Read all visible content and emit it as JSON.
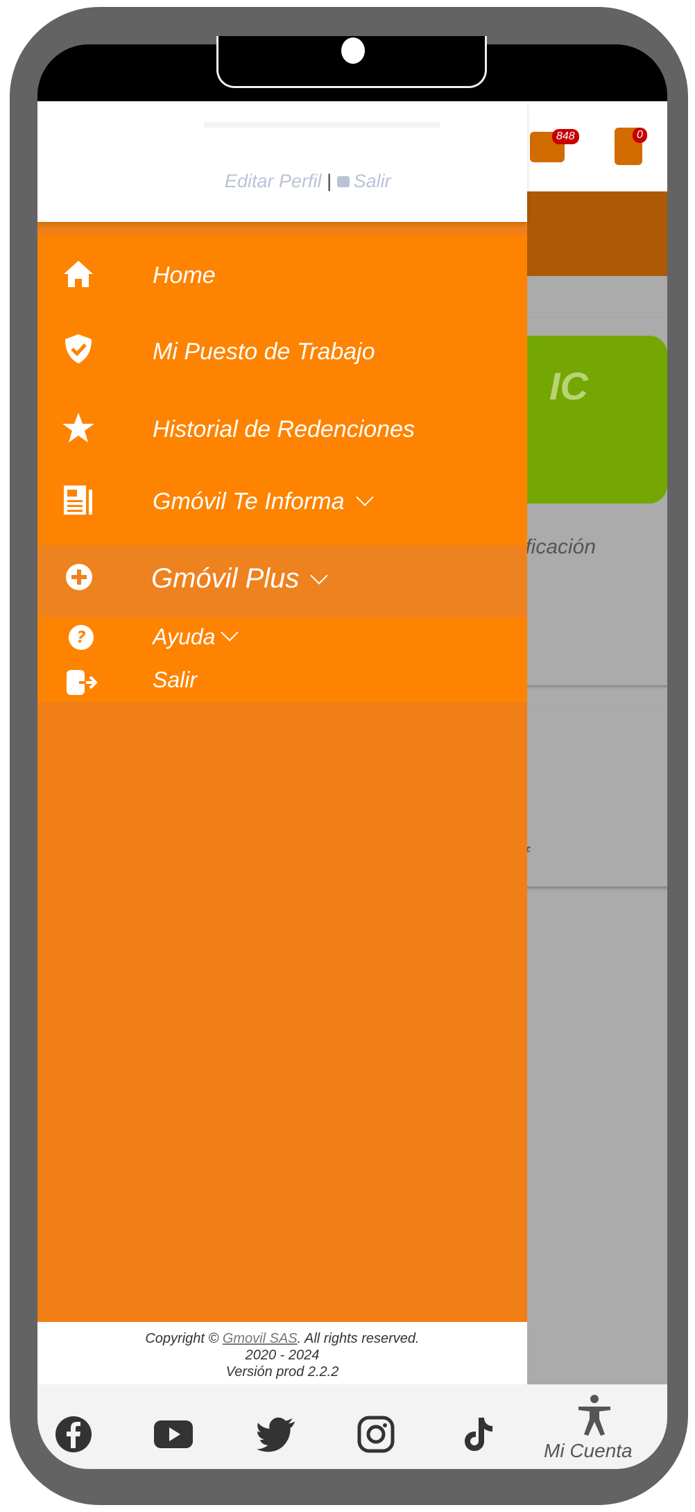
{
  "background_app": {
    "mail_badge": "848",
    "doc_badge": "0",
    "card_text_partial": "IC",
    "card_caption_partial": "lificación",
    "card2_partial": "f",
    "bottom_nav_label": "Mi Cuenta"
  },
  "drawer": {
    "header": {
      "edit_profile": "Editar Perfil",
      "separator": " | ",
      "logout": "Salir"
    },
    "menu": [
      {
        "label": "Home",
        "icon": "home-icon",
        "has_submenu": false
      },
      {
        "label": "Mi Puesto de Trabajo",
        "icon": "shield-check-icon",
        "has_submenu": false
      },
      {
        "label": "Historial de Redenciones",
        "icon": "star-icon",
        "has_submenu": false
      },
      {
        "label": "Gmóvil Te Informa",
        "icon": "newspaper-icon",
        "has_submenu": true
      },
      {
        "label": "Gmóvil Plus",
        "icon": "plus-circle-icon",
        "has_submenu": true
      },
      {
        "label": "Ayuda",
        "icon": "question-circle-icon",
        "has_submenu": true
      },
      {
        "label": "Salir",
        "icon": "sign-out-icon",
        "has_submenu": false
      }
    ],
    "footer": {
      "copyright_prefix": "Copyright © ",
      "company": "Gmovil SAS",
      "copyright_suffix": ". All rights reserved.",
      "years": "2020 - 2024",
      "version": "Versión prod 2.2.2"
    },
    "social": [
      "facebook-icon",
      "youtube-icon",
      "twitter-icon",
      "instagram-icon",
      "tiktok-icon"
    ]
  },
  "colors": {
    "drawer_orange": "#fe8300",
    "drawer_lower": "#f07f15",
    "frame": "#636363",
    "accent_green": "#74a702"
  }
}
